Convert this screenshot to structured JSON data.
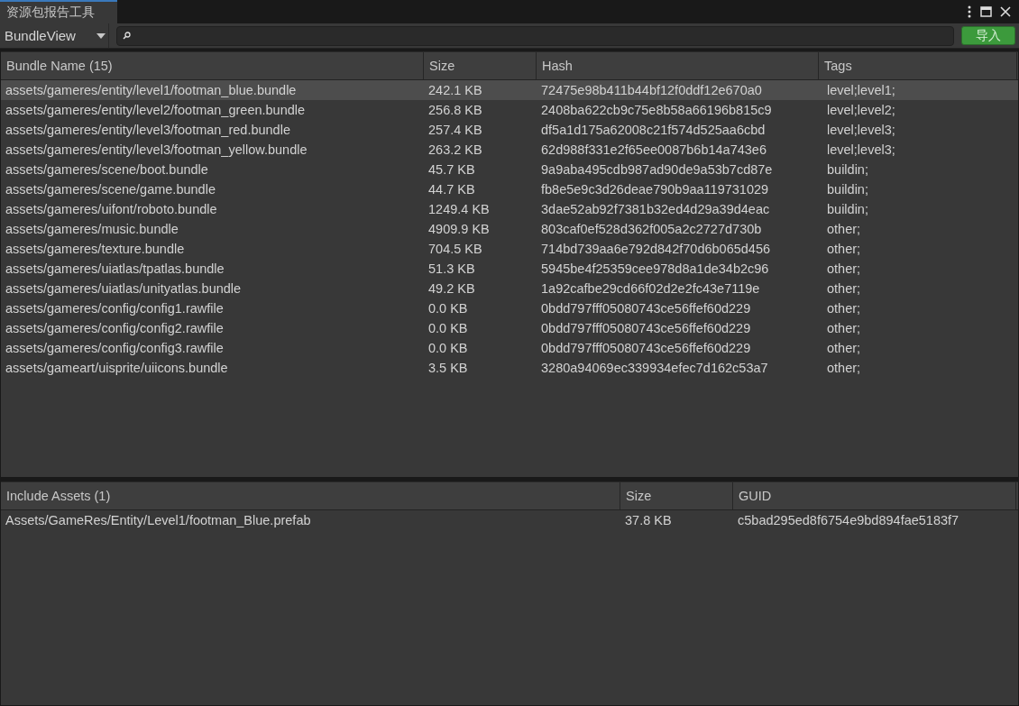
{
  "window": {
    "title": "资源包报告工具",
    "selected": true
  },
  "toolbar": {
    "view_dropdown": "BundleView",
    "import_button": "导入"
  },
  "bundle_table": {
    "columns": [
      "Bundle Name (15)",
      "Size",
      "Hash",
      "Tags"
    ],
    "rows": [
      {
        "cells": [
          "assets/gameres/entity/level1/footman_blue.bundle",
          "242.1 KB",
          "72475e98b411b44bf12f0ddf12e670a0",
          "level;level1;"
        ],
        "selected": true
      },
      {
        "cells": [
          "assets/gameres/entity/level2/footman_green.bundle",
          "256.8 KB",
          "2408ba622cb9c75e8b58a66196b815c9",
          "level;level2;"
        ],
        "selected": false
      },
      {
        "cells": [
          "assets/gameres/entity/level3/footman_red.bundle",
          "257.4 KB",
          "df5a1d175a62008c21f574d525aa6cbd",
          "level;level3;"
        ],
        "selected": false
      },
      {
        "cells": [
          "assets/gameres/entity/level3/footman_yellow.bundle",
          "263.2 KB",
          "62d988f331e2f65ee0087b6b14a743e6",
          "level;level3;"
        ],
        "selected": false
      },
      {
        "cells": [
          "assets/gameres/scene/boot.bundle",
          "45.7 KB",
          "9a9aba495cdb987ad90de9a53b7cd87e",
          "buildin;"
        ],
        "selected": false
      },
      {
        "cells": [
          "assets/gameres/scene/game.bundle",
          "44.7 KB",
          "fb8e5e9c3d26deae790b9aa119731029",
          "buildin;"
        ],
        "selected": false
      },
      {
        "cells": [
          "assets/gameres/uifont/roboto.bundle",
          "1249.4 KB",
          "3dae52ab92f7381b32ed4d29a39d4eac",
          "buildin;"
        ],
        "selected": false
      },
      {
        "cells": [
          "assets/gameres/music.bundle",
          "4909.9 KB",
          "803caf0ef528d362f005a2c2727d730b",
          "other;"
        ],
        "selected": false
      },
      {
        "cells": [
          "assets/gameres/texture.bundle",
          "704.5 KB",
          "714bd739aa6e792d842f70d6b065d456",
          "other;"
        ],
        "selected": false
      },
      {
        "cells": [
          "assets/gameres/uiatlas/tpatlas.bundle",
          "51.3 KB",
          "5945be4f25359cee978d8a1de34b2c96",
          "other;"
        ],
        "selected": false
      },
      {
        "cells": [
          "assets/gameres/uiatlas/unityatlas.bundle",
          "49.2 KB",
          "1a92cafbe29cd66f02d2e2fc43e7119e",
          "other;"
        ],
        "selected": false
      },
      {
        "cells": [
          "assets/gameres/config/config1.rawfile",
          "0.0 KB",
          "0bdd797fff05080743ce56ffef60d229",
          "other;"
        ],
        "selected": false
      },
      {
        "cells": [
          "assets/gameres/config/config2.rawfile",
          "0.0 KB",
          "0bdd797fff05080743ce56ffef60d229",
          "other;"
        ],
        "selected": false
      },
      {
        "cells": [
          "assets/gameres/config/config3.rawfile",
          "0.0 KB",
          "0bdd797fff05080743ce56ffef60d229",
          "other;"
        ],
        "selected": false
      },
      {
        "cells": [
          "assets/gameart/uisprite/uiicons.bundle",
          "3.5 KB",
          "3280a94069ec339934efec7d162c53a7",
          "other;"
        ],
        "selected": false
      }
    ]
  },
  "assets_table": {
    "columns": [
      "Include Assets (1)",
      "Size",
      "GUID"
    ],
    "rows": [
      {
        "cells": [
          "Assets/GameRes/Entity/Level1/footman_Blue.prefab",
          "37.8 KB",
          "c5bad295ed8f6754e9bd894fae5183f7"
        ],
        "selected": false
      }
    ]
  }
}
